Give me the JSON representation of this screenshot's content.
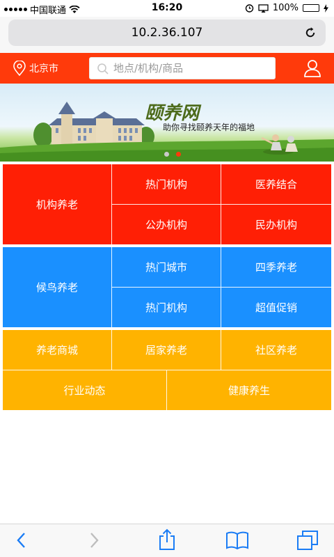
{
  "status_bar": {
    "carrier": "中国联通",
    "time": "16:20",
    "battery": "100%",
    "battery_level": 1.0
  },
  "browser": {
    "url": "10.2.36.107"
  },
  "header": {
    "city": "北京市",
    "search_placeholder": "地点/机构/商品"
  },
  "banner": {
    "title": "颐养网",
    "slogan": "助你寻找颐养天年的福地",
    "slide_count": 2,
    "active_slide": 2
  },
  "menu": {
    "red": {
      "main": "机构养老",
      "items": [
        "热门机构",
        "医养结合",
        "公办机构",
        "民办机构"
      ]
    },
    "blue": {
      "main": "候鸟养老",
      "items": [
        "热门城市",
        "四季养老",
        "热门机构",
        "超值促销"
      ]
    },
    "yellow": {
      "row1": [
        "养老商城",
        "居家养老",
        "社区养老"
      ],
      "row2": [
        "行业动态",
        "健康养生"
      ]
    }
  },
  "colors": {
    "header": "#ff3a0b",
    "red": "#ff1f05",
    "blue": "#1a90ff",
    "yellow": "#ffb300",
    "tint": "#1a7cf5"
  }
}
